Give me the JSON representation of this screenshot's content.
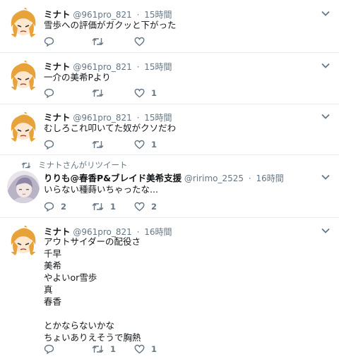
{
  "tweets": [
    {
      "name": "ミナト",
      "handle": "@961pro_821",
      "time": "15時間",
      "lines": [
        "雪歩への評価がガクッと下がった"
      ],
      "replies": "",
      "retweets": "",
      "likes": ""
    },
    {
      "name": "ミナト",
      "handle": "@961pro_821",
      "time": "15時間",
      "lines": [
        "一介の美希Pより"
      ],
      "replies": "",
      "retweets": "",
      "likes": "1"
    },
    {
      "name": "ミナト",
      "handle": "@961pro_821",
      "time": "15時間",
      "lines": [
        "むしろこれ叩いてた奴がクソだわ"
      ],
      "replies": "",
      "retweets": "",
      "likes": "1"
    },
    {
      "context": "ミナトさんがリツイート",
      "name": "りりも@春香P&ブレイド美希支援",
      "handle": "@ririmo_2525",
      "time": "16時間",
      "lines": [
        "いらない種蒔いちゃったな..."
      ],
      "replies": "2",
      "retweets": "1",
      "likes": "2"
    },
    {
      "name": "ミナト",
      "handle": "@961pro_821",
      "time": "16時間",
      "lines": [
        "アウトサイダーの配役さ",
        "千早",
        "美希",
        "やよいor雪歩",
        "真",
        "春香",
        "",
        "とかならないかな",
        "ちょいありえそうで胸熱"
      ],
      "replies": "",
      "retweets": "1",
      "likes": "1"
    }
  ],
  "colors": {
    "text": "#14171a",
    "muted": "#657786",
    "divider": "#e6ecf0"
  }
}
